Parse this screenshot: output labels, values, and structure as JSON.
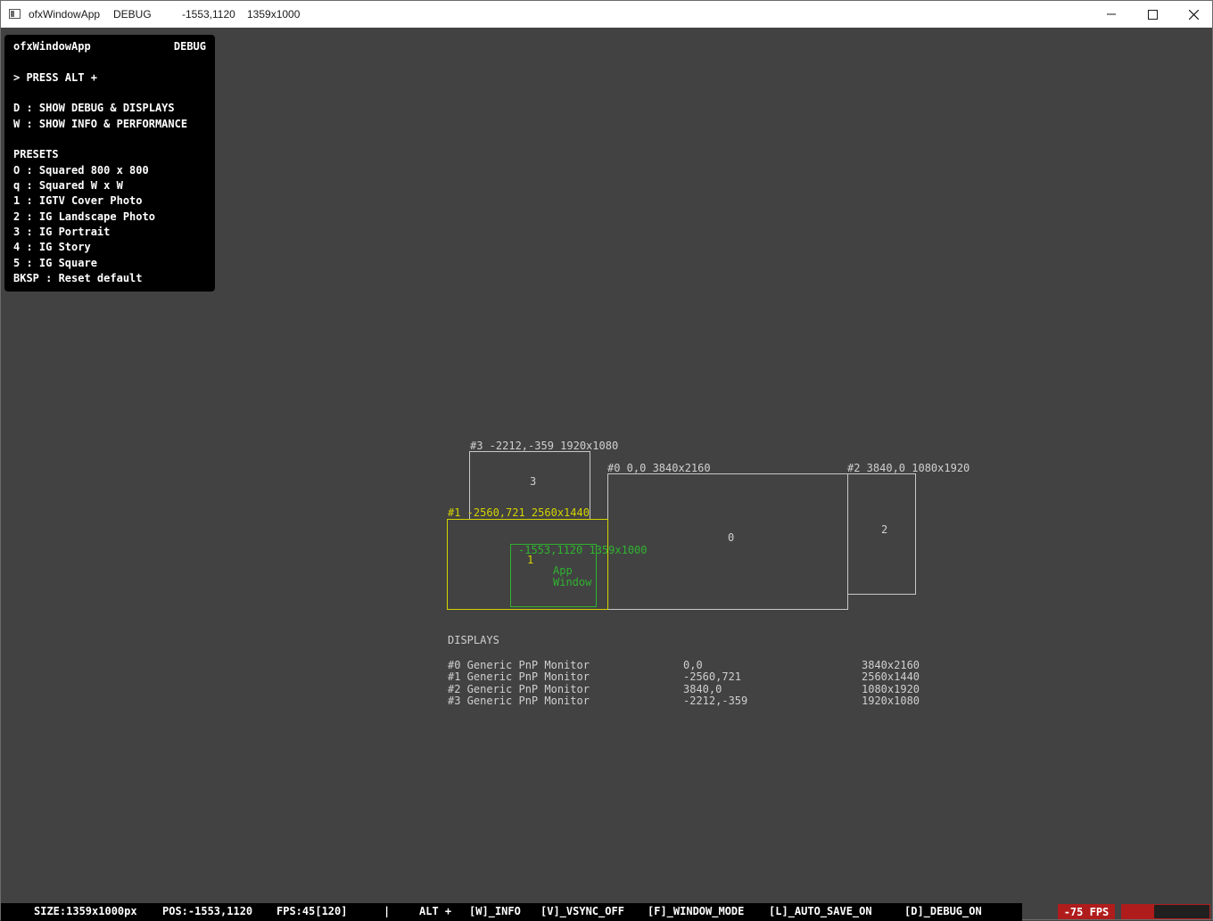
{
  "titlebar": {
    "app_name": "ofxWindowApp",
    "mode": "DEBUG",
    "position": "-1553,1120",
    "size": "1359x1000"
  },
  "help_panel": {
    "title": "ofxWindowApp",
    "mode": "DEBUG",
    "press": "> PRESS ALT +",
    "lines": [
      "D : SHOW DEBUG & DISPLAYS",
      "W : SHOW INFO & PERFORMANCE"
    ],
    "presets_header": "PRESETS",
    "presets": [
      "O : Squared 800 x 800",
      "q : Squared W x W",
      "1 : IGTV Cover Photo",
      "2 : IG Landscape Photo",
      "3 : IG Portrait",
      "4 : IG Story",
      "5 : IG Square",
      "BKSP : Reset default"
    ]
  },
  "monitors": {
    "m3": {
      "label": "#3 -2212,-359 1920x1080",
      "number": "3"
    },
    "m0": {
      "label": "#0 0,0 3840x2160",
      "number": "0"
    },
    "m2": {
      "label": "#2 3840,0 1080x1920",
      "number": "2"
    },
    "m1": {
      "label": "#1 -2560,721 2560x1440",
      "number": "1"
    },
    "app_window": {
      "label": "-1553,1120 1359x1000",
      "line1": "App",
      "line2": "Window"
    }
  },
  "displays": {
    "header": "DISPLAYS",
    "rows": [
      {
        "name": "#0 Generic PnP Monitor",
        "pos": "0,0",
        "size": "3840x2160"
      },
      {
        "name": "#1 Generic PnP Monitor",
        "pos": "-2560,721",
        "size": "2560x1440"
      },
      {
        "name": "#2 Generic PnP Monitor",
        "pos": "3840,0",
        "size": "1080x1920"
      },
      {
        "name": "#3 Generic PnP Monitor",
        "pos": "-2212,-359",
        "size": "1920x1080"
      }
    ]
  },
  "statusbar": {
    "size": "SIZE:1359x1000px",
    "pos": "POS:-1553,1120",
    "fps": "FPS:45[120]",
    "sep": "|",
    "alt": "ALT +",
    "info": "[W]_INFO",
    "vsync": "[V]_VSYNC_OFF",
    "window_mode": "[F]_WINDOW_MODE",
    "auto_save": "[L]_AUTO_SAVE_ON",
    "debug": "[D]_DEBUG_ON"
  },
  "fps_badge": {
    "text": "-75 FPS",
    "fill_fraction": 0.37
  },
  "colors": {
    "background": "#424242",
    "monitor": "#c8c8c8",
    "current_monitor": "#d4d400",
    "app_window": "#2fb32f",
    "fps_warning": "#b01c1c"
  }
}
